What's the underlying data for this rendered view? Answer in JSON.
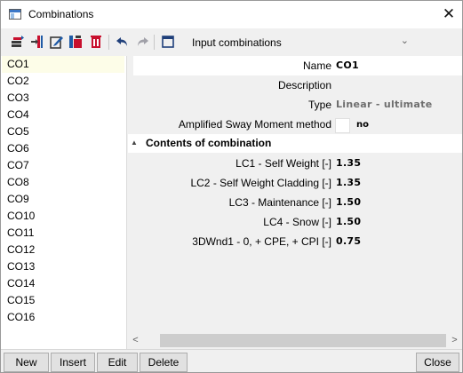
{
  "window": {
    "title": "Combinations",
    "close_glyph": "✕"
  },
  "toolbar": {
    "icons": [
      "new-combination-icon",
      "insert-icon",
      "edit-icon",
      "copy-icon",
      "delete-icon",
      "undo-icon",
      "redo-icon",
      "table-icon"
    ],
    "dropdown_value": "Input combinations",
    "dropdown_arrow": "⌄"
  },
  "list": {
    "items": [
      "CO1",
      "CO2",
      "CO3",
      "CO4",
      "CO5",
      "CO6",
      "CO7",
      "CO8",
      "CO9",
      "CO10",
      "CO11",
      "CO12",
      "CO13",
      "CO14",
      "CO15",
      "CO16"
    ],
    "selected": "CO1"
  },
  "properties": {
    "name_label": "Name",
    "name_value": "CO1",
    "description_label": "Description",
    "description_value": "",
    "type_label": "Type",
    "type_value": "Linear - ultimate",
    "amplified_label": "Amplified Sway Moment method",
    "amplified_value": "no",
    "section_title": "Contents of combination",
    "cases": [
      {
        "label": "LC1 - Self Weight [-]",
        "value": "1.35"
      },
      {
        "label": "LC2 - Self Weight Cladding [-]",
        "value": "1.35"
      },
      {
        "label": "LC3 - Maintenance [-]",
        "value": "1.50"
      },
      {
        "label": "LC4 - Snow [-]",
        "value": "1.50"
      },
      {
        "label": "3DWnd1 - 0, + CPE, + CPI [-]",
        "value": "0.75"
      }
    ]
  },
  "scrollbar": {
    "left_arrow": "<",
    "right_arrow": ">"
  },
  "buttons": {
    "new": "New",
    "insert": "Insert",
    "edit": "Edit",
    "delete": "Delete",
    "close": "Close"
  },
  "colors": {
    "selected_row": "#fdfde8",
    "accent_red": "#c8102e",
    "accent_blue": "#1f5aa6",
    "dark": "#3a3a3a"
  }
}
